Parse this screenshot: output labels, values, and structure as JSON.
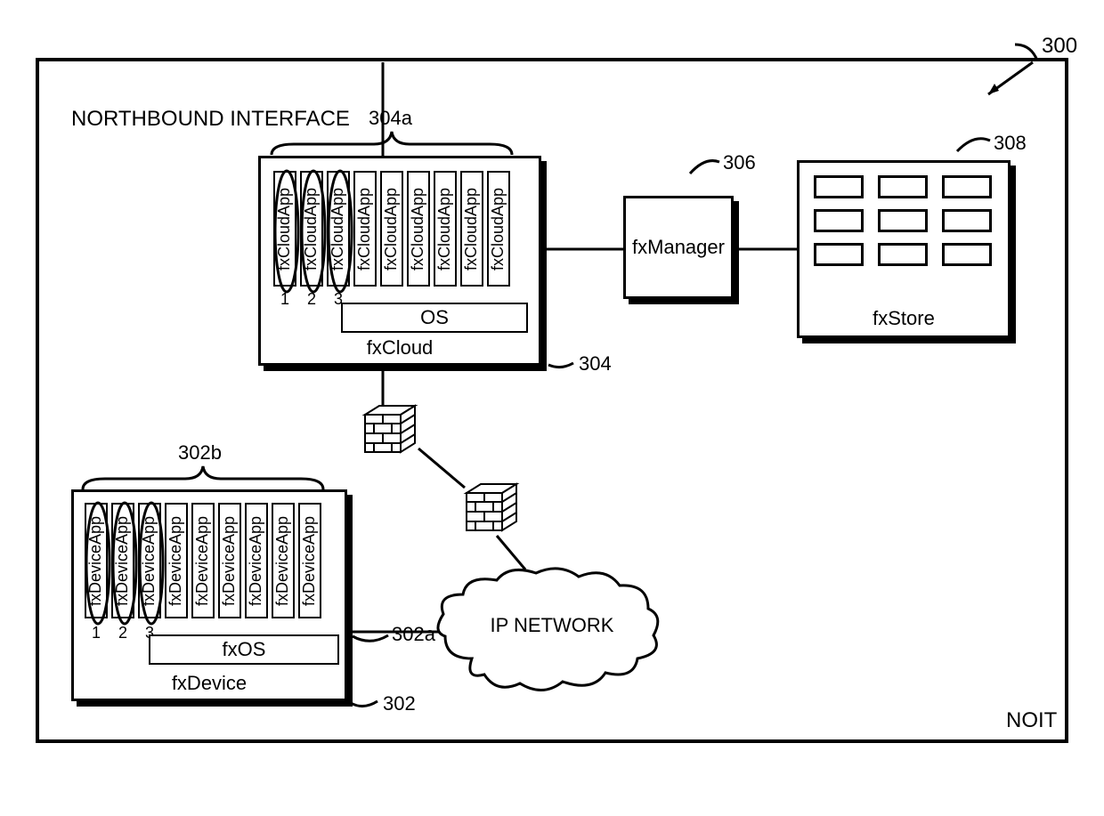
{
  "refs": {
    "outer": "300",
    "fxcloud": "304",
    "fxcloud_apps": "304a",
    "fxdevice": "302",
    "fxdevice_os": "302a",
    "fxdevice_apps": "302b",
    "fxmanager": "306",
    "fxstore": "308"
  },
  "text": {
    "northbound": "NORTHBOUND INTERFACE",
    "noit": "NOIT",
    "fxcloud_title": "fxCloud",
    "fxcloud_os": "OS",
    "fxdevice_title": "fxDevice",
    "fxdevice_os": "fxOS",
    "fxmanager": "fxManager",
    "fxstore": "fxStore",
    "ipnetwork": "IP NETWORK",
    "cloud_app": "fxCloudApp",
    "device_app": "fxDeviceApp"
  },
  "nums": [
    "1",
    "2",
    "3"
  ]
}
